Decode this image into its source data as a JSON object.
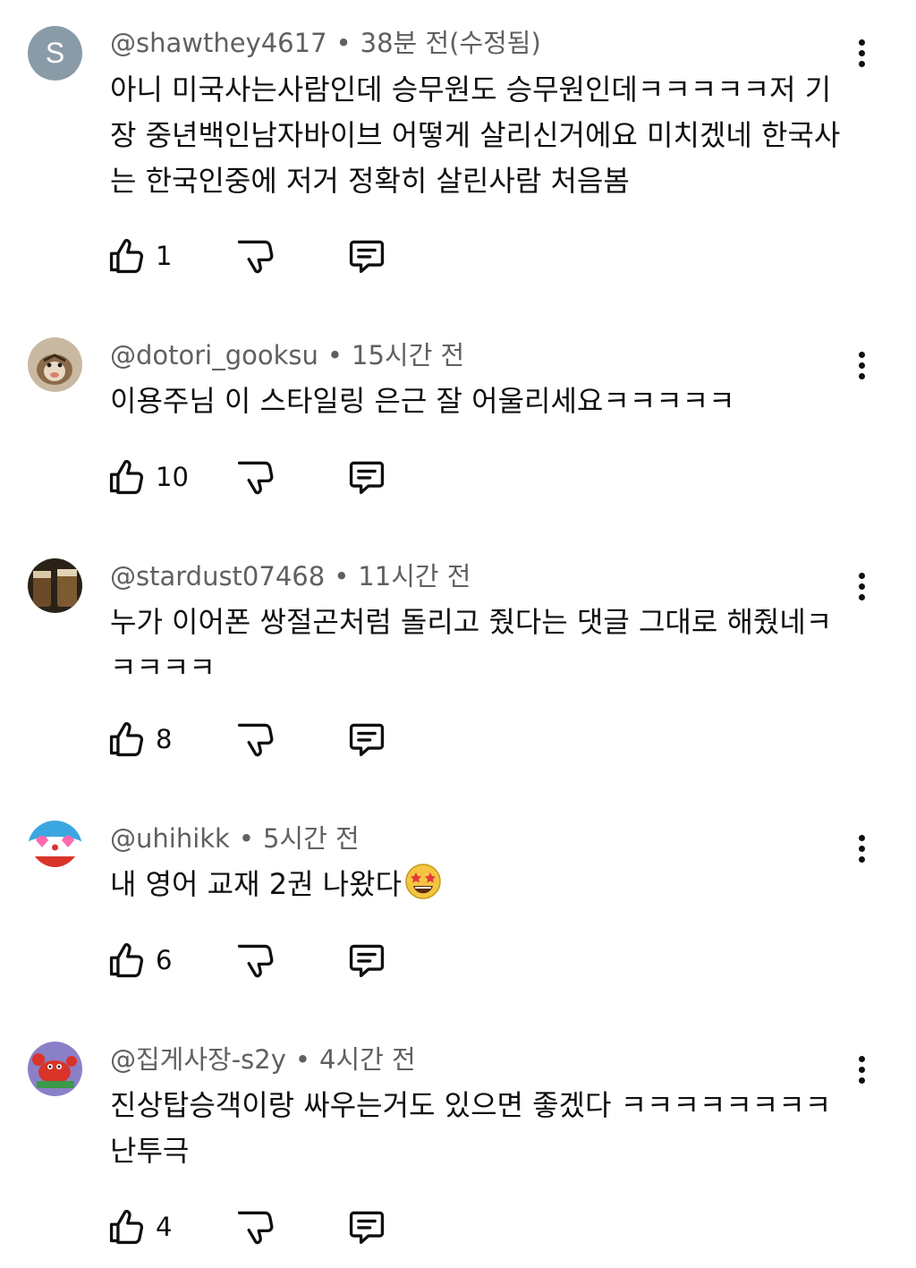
{
  "comments": [
    {
      "handle": "@shawthey4617",
      "time": "38분 전(수정됨)",
      "text": "아니 미국사는사람인데 승무원도 승무원인데ㅋㅋㅋㅋㅋ저 기장 중년백인남자바이브 어떻게 살리신거에요 미치겠네 한국사는 한국인중에 저거 정확히 살린사람 처음봄",
      "likes": "1",
      "avatar_letter": "S"
    },
    {
      "handle": "@dotori_gooksu",
      "time": "15시간 전",
      "text": "이용주님 이 스타일링 은근 잘 어울리세요ㅋㅋㅋㅋㅋ",
      "likes": "10"
    },
    {
      "handle": "@stardust07468",
      "time": "11시간 전",
      "text": "누가 이어폰 쌍절곤처럼 돌리고 줬다는 댓글 그대로 해줬네ㅋㅋㅋㅋㅋ",
      "likes": "8"
    },
    {
      "handle": "@uhihikk",
      "time": "5시간 전",
      "text": "내 영어 교재 2권 나왔다",
      "likes": "6",
      "emoji": "star-struck-emoji"
    },
    {
      "handle": "@집게사장-s2y",
      "time": "4시간 전",
      "text": "진상탑승객이랑 싸우는거도 있으면 좋겠다 ㅋㅋㅋㅋㅋㅋㅋㅋ 난투극",
      "likes": "4"
    }
  ],
  "icons": {
    "like": "thumbs-up-icon",
    "dislike": "thumbs-down-icon",
    "reply": "reply-comment-icon",
    "more": "more-vertical-icon"
  },
  "meta_separator": "•"
}
